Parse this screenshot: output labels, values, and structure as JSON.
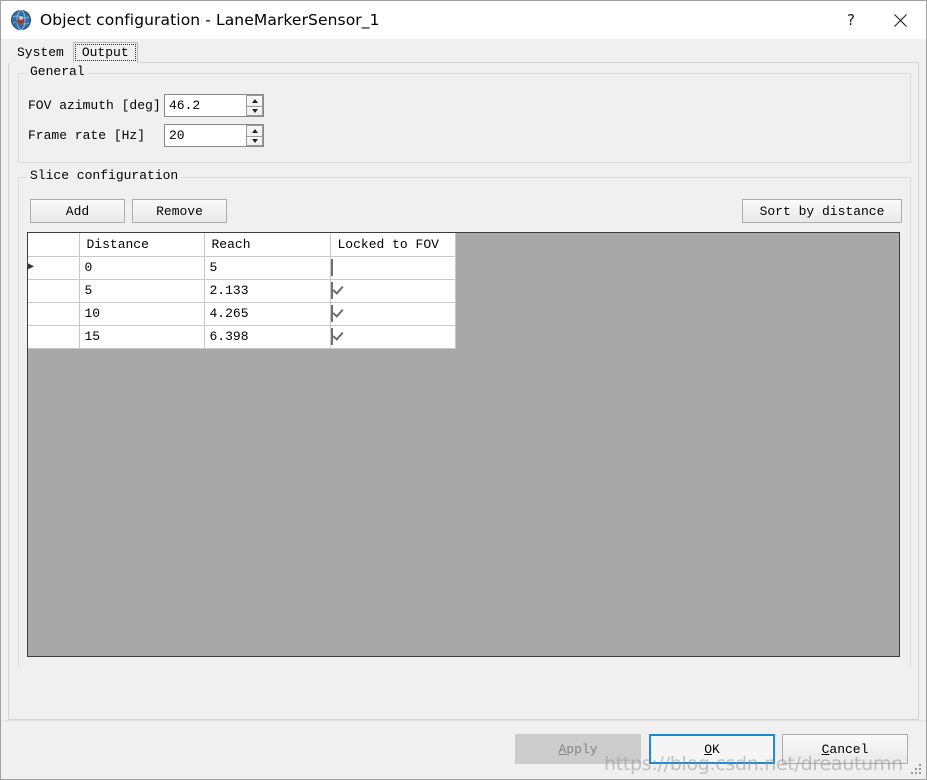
{
  "window": {
    "title": "Object configuration - LaneMarkerSensor_1",
    "icon": "globe-sensor-icon",
    "help_label": "?",
    "close_label": "×"
  },
  "tabs": [
    {
      "label": "System",
      "active": false
    },
    {
      "label": "Output",
      "active": true
    }
  ],
  "general": {
    "group_title": "General",
    "fields": [
      {
        "label": "FOV azimuth [deg]",
        "value": "46.2"
      },
      {
        "label": "Frame rate [Hz]",
        "value": "20"
      }
    ]
  },
  "slice": {
    "group_title": "Slice configuration",
    "buttons": {
      "add": "Add",
      "remove": "Remove",
      "sort": "Sort by distance"
    },
    "table": {
      "columns": [
        "",
        "Distance",
        "Reach",
        "Locked to FOV"
      ],
      "rows": [
        {
          "marker": "▶",
          "distance": "0",
          "reach": "5",
          "locked": false,
          "selected": true
        },
        {
          "marker": "",
          "distance": "5",
          "reach": "2.133",
          "locked": true,
          "selected": false
        },
        {
          "marker": "",
          "distance": "10",
          "reach": "4.265",
          "locked": true,
          "selected": false
        },
        {
          "marker": "",
          "distance": "15",
          "reach": "6.398",
          "locked": true,
          "selected": false
        }
      ]
    }
  },
  "footer": {
    "apply": "Apply",
    "apply_mnemonic": "A",
    "apply_rest": "pply",
    "ok": "OK",
    "ok_mnemonic": "O",
    "ok_rest": "K",
    "cancel": "Cancel",
    "cancel_mnemonic": "C",
    "cancel_rest": "ancel"
  },
  "watermark": {
    "text": "https://blog.csdn.net/dreautumn"
  },
  "colors": {
    "selection_blue": "#0f7ac8",
    "focus_blue": "#1c8ad8",
    "grid_backdrop": "#a8a8a8",
    "dialog_bg": "#f0f0f0"
  }
}
